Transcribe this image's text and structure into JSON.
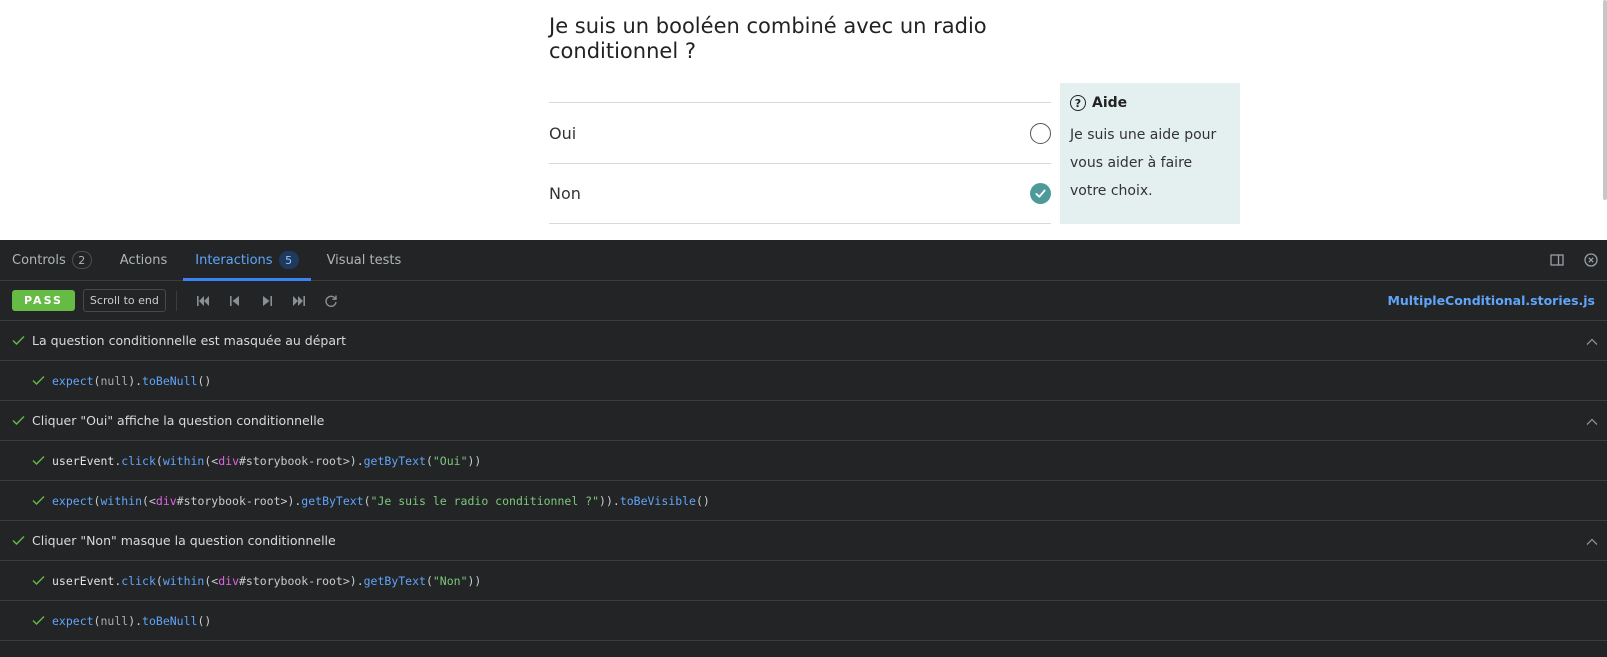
{
  "preview": {
    "question_title": "Je suis un booléen combiné avec un radio conditionnel ?",
    "options": [
      {
        "label": "Oui",
        "checked": false
      },
      {
        "label": "Non",
        "checked": true
      }
    ],
    "help": {
      "title": "Aide",
      "text": "Je suis une aide pour vous aider à faire votre choix."
    }
  },
  "panel": {
    "tabs": [
      {
        "label": "Controls",
        "badge": "2",
        "active": false
      },
      {
        "label": "Actions",
        "badge": "",
        "active": false
      },
      {
        "label": "Interactions",
        "badge": "5",
        "active": true
      },
      {
        "label": "Visual tests",
        "badge": "",
        "active": false
      }
    ],
    "toolbar": {
      "status": "PASS",
      "scroll_label": "Scroll to end",
      "file": "MultipleConditional.stories.js"
    },
    "groups": [
      {
        "label": "La question conditionnelle est masquée au départ",
        "steps": [
          [
            [
              "c-fn",
              "expect"
            ],
            [
              "",
              "("
            ],
            [
              "c-null",
              "null"
            ],
            [
              "",
              ")."
            ],
            [
              "c-fn",
              "toBeNull"
            ],
            [
              "",
              "()"
            ]
          ]
        ]
      },
      {
        "label": "Cliquer \"Oui\" affiche la question conditionnelle",
        "steps": [
          [
            [
              "c-obj",
              "userEvent"
            ],
            [
              "",
              "."
            ],
            [
              "c-fn",
              "click"
            ],
            [
              "",
              "("
            ],
            [
              "c-fn",
              "within"
            ],
            [
              "",
              "(<"
            ],
            [
              "c-tag",
              "div"
            ],
            [
              "",
              "#storybook-root>)."
            ],
            [
              "c-fn",
              "getByText"
            ],
            [
              "",
              "("
            ],
            [
              "c-str",
              "\"Oui\""
            ],
            [
              "",
              "))"
            ]
          ],
          [
            [
              "c-fn",
              "expect"
            ],
            [
              "",
              "("
            ],
            [
              "c-fn",
              "within"
            ],
            [
              "",
              "(<"
            ],
            [
              "c-tag",
              "div"
            ],
            [
              "",
              "#storybook-root>)."
            ],
            [
              "c-fn",
              "getByText"
            ],
            [
              "",
              "("
            ],
            [
              "c-str",
              "\"Je suis le radio conditionnel ?\""
            ],
            [
              "",
              "))."
            ],
            [
              "c-fn",
              "toBeVisible"
            ],
            [
              "",
              "()"
            ]
          ]
        ]
      },
      {
        "label": "Cliquer \"Non\" masque la question conditionnelle",
        "steps": [
          [
            [
              "c-obj",
              "userEvent"
            ],
            [
              "",
              "."
            ],
            [
              "c-fn",
              "click"
            ],
            [
              "",
              "("
            ],
            [
              "c-fn",
              "within"
            ],
            [
              "",
              "(<"
            ],
            [
              "c-tag",
              "div"
            ],
            [
              "",
              "#storybook-root>)."
            ],
            [
              "c-fn",
              "getByText"
            ],
            [
              "",
              "("
            ],
            [
              "c-str",
              "\"Non\""
            ],
            [
              "",
              "))"
            ]
          ],
          [
            [
              "c-fn",
              "expect"
            ],
            [
              "",
              "("
            ],
            [
              "c-null",
              "null"
            ],
            [
              "",
              ")."
            ],
            [
              "c-fn",
              "toBeNull"
            ],
            [
              "",
              "()"
            ]
          ]
        ]
      }
    ],
    "colors": {
      "accent": "#3b82f6",
      "pass": "#66bb44",
      "checked_radio": "#4e9a9a",
      "help_bg": "#e3f0ef"
    }
  }
}
